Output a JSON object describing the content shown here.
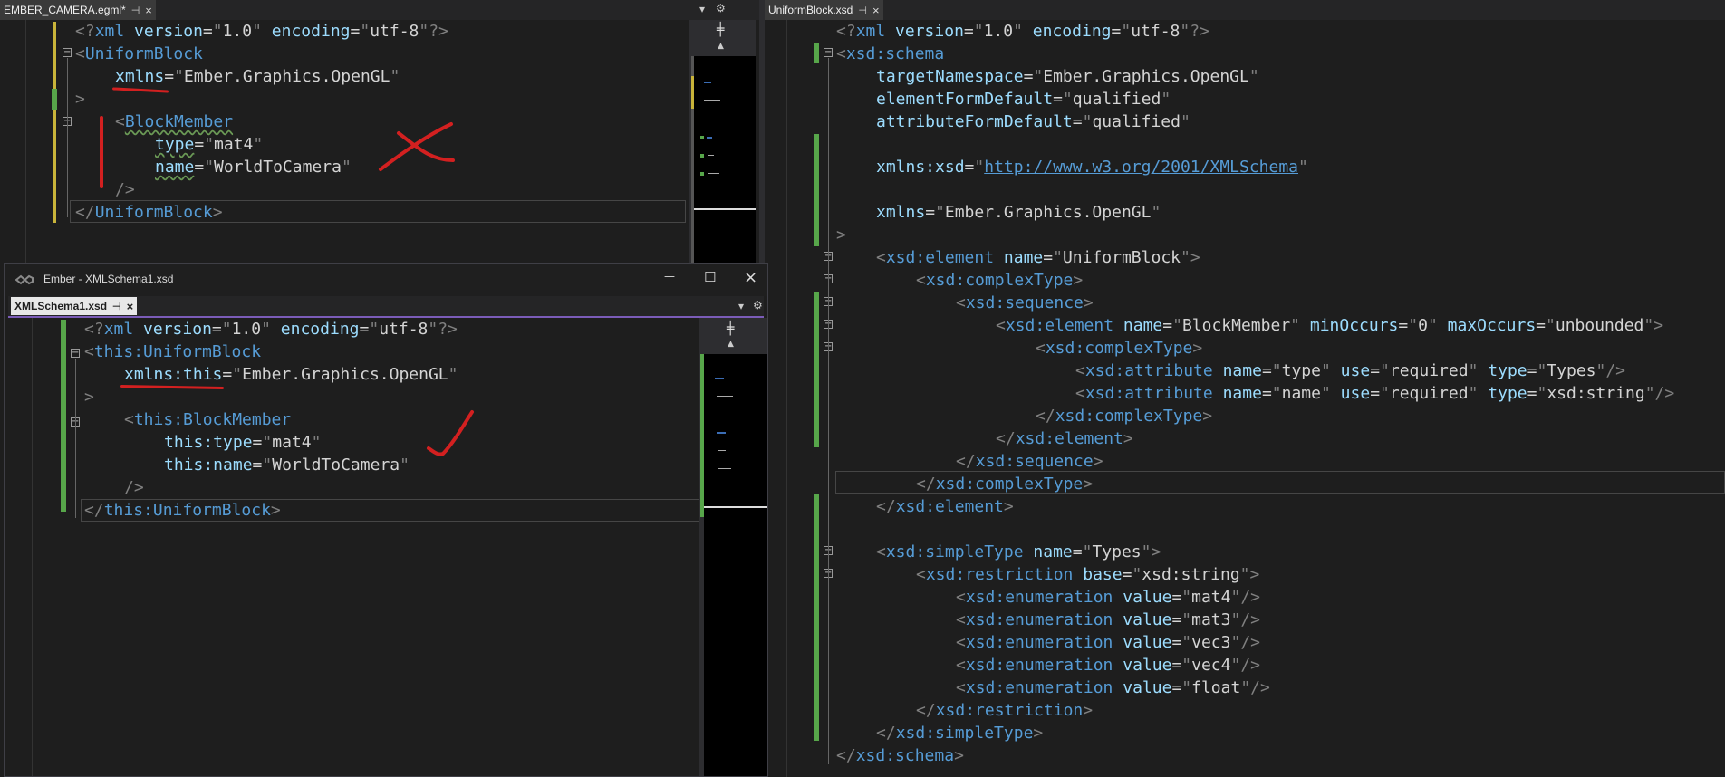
{
  "left_top": {
    "tab_title": "EMBER_CAMERA.egml*",
    "lines": [
      "<?xml version=\"1.0\" encoding=\"utf-8\"?>",
      "<UniformBlock",
      "    xmlns=\"Ember.Graphics.OpenGL\"",
      ">",
      "    <BlockMember",
      "        type=\"mat4\"",
      "        name=\"WorldToCamera\"",
      "    />",
      "</UniformBlock>"
    ]
  },
  "floating_window": {
    "title": "Ember - XMLSchema1.xsd",
    "tab_title": "XMLSchema1.xsd",
    "lines": [
      "<?xml version=\"1.0\" encoding=\"utf-8\"?>",
      "<this:UniformBlock",
      "    xmlns:this=\"Ember.Graphics.OpenGL\"",
      ">",
      "    <this:BlockMember",
      "        this:type=\"mat4\"",
      "        this:name=\"WorldToCamera\"",
      "    />",
      "</this:UniformBlock>"
    ]
  },
  "right": {
    "tab_title": "UniformBlock.xsd",
    "lines": [
      "<?xml version=\"1.0\" encoding=\"utf-8\"?>",
      "<xsd:schema",
      "    targetNamespace=\"Ember.Graphics.OpenGL\"",
      "    elementFormDefault=\"qualified\"",
      "    attributeFormDefault=\"qualified\"",
      "",
      "    xmlns:xsd=\"http://www.w3.org/2001/XMLSchema\"",
      "",
      "    xmlns=\"Ember.Graphics.OpenGL\"",
      ">",
      "    <xsd:element name=\"UniformBlock\">",
      "        <xsd:complexType>",
      "            <xsd:sequence>",
      "                <xsd:element name=\"BlockMember\" minOccurs=\"0\" maxOccurs=\"unbounded\">",
      "                    <xsd:complexType>",
      "                        <xsd:attribute name=\"type\" use=\"required\" type=\"Types\"/>",
      "                        <xsd:attribute name=\"name\" use=\"required\" type=\"xsd:string\"/>",
      "                    </xsd:complexType>",
      "                </xsd:element>",
      "            </xsd:sequence>",
      "        </xsd:complexType>",
      "    </xsd:element>",
      "",
      "    <xsd:simpleType name=\"Types\">",
      "        <xsd:restriction base=\"xsd:string\">",
      "            <xsd:enumeration value=\"mat4\"/>",
      "            <xsd:enumeration value=\"mat3\"/>",
      "            <xsd:enumeration value=\"vec3\"/>",
      "            <xsd:enumeration value=\"vec4\"/>",
      "            <xsd:enumeration value=\"float\"/>",
      "        </xsd:restriction>",
      "    </xsd:simpleType>",
      "</xsd:schema>"
    ]
  },
  "icons": {
    "close": "×",
    "pin": "⊣",
    "dropdown": "▾",
    "settings": "⚙",
    "minimize": "—",
    "maximize": "☐",
    "split": "╪",
    "scroll_up": "▲"
  }
}
